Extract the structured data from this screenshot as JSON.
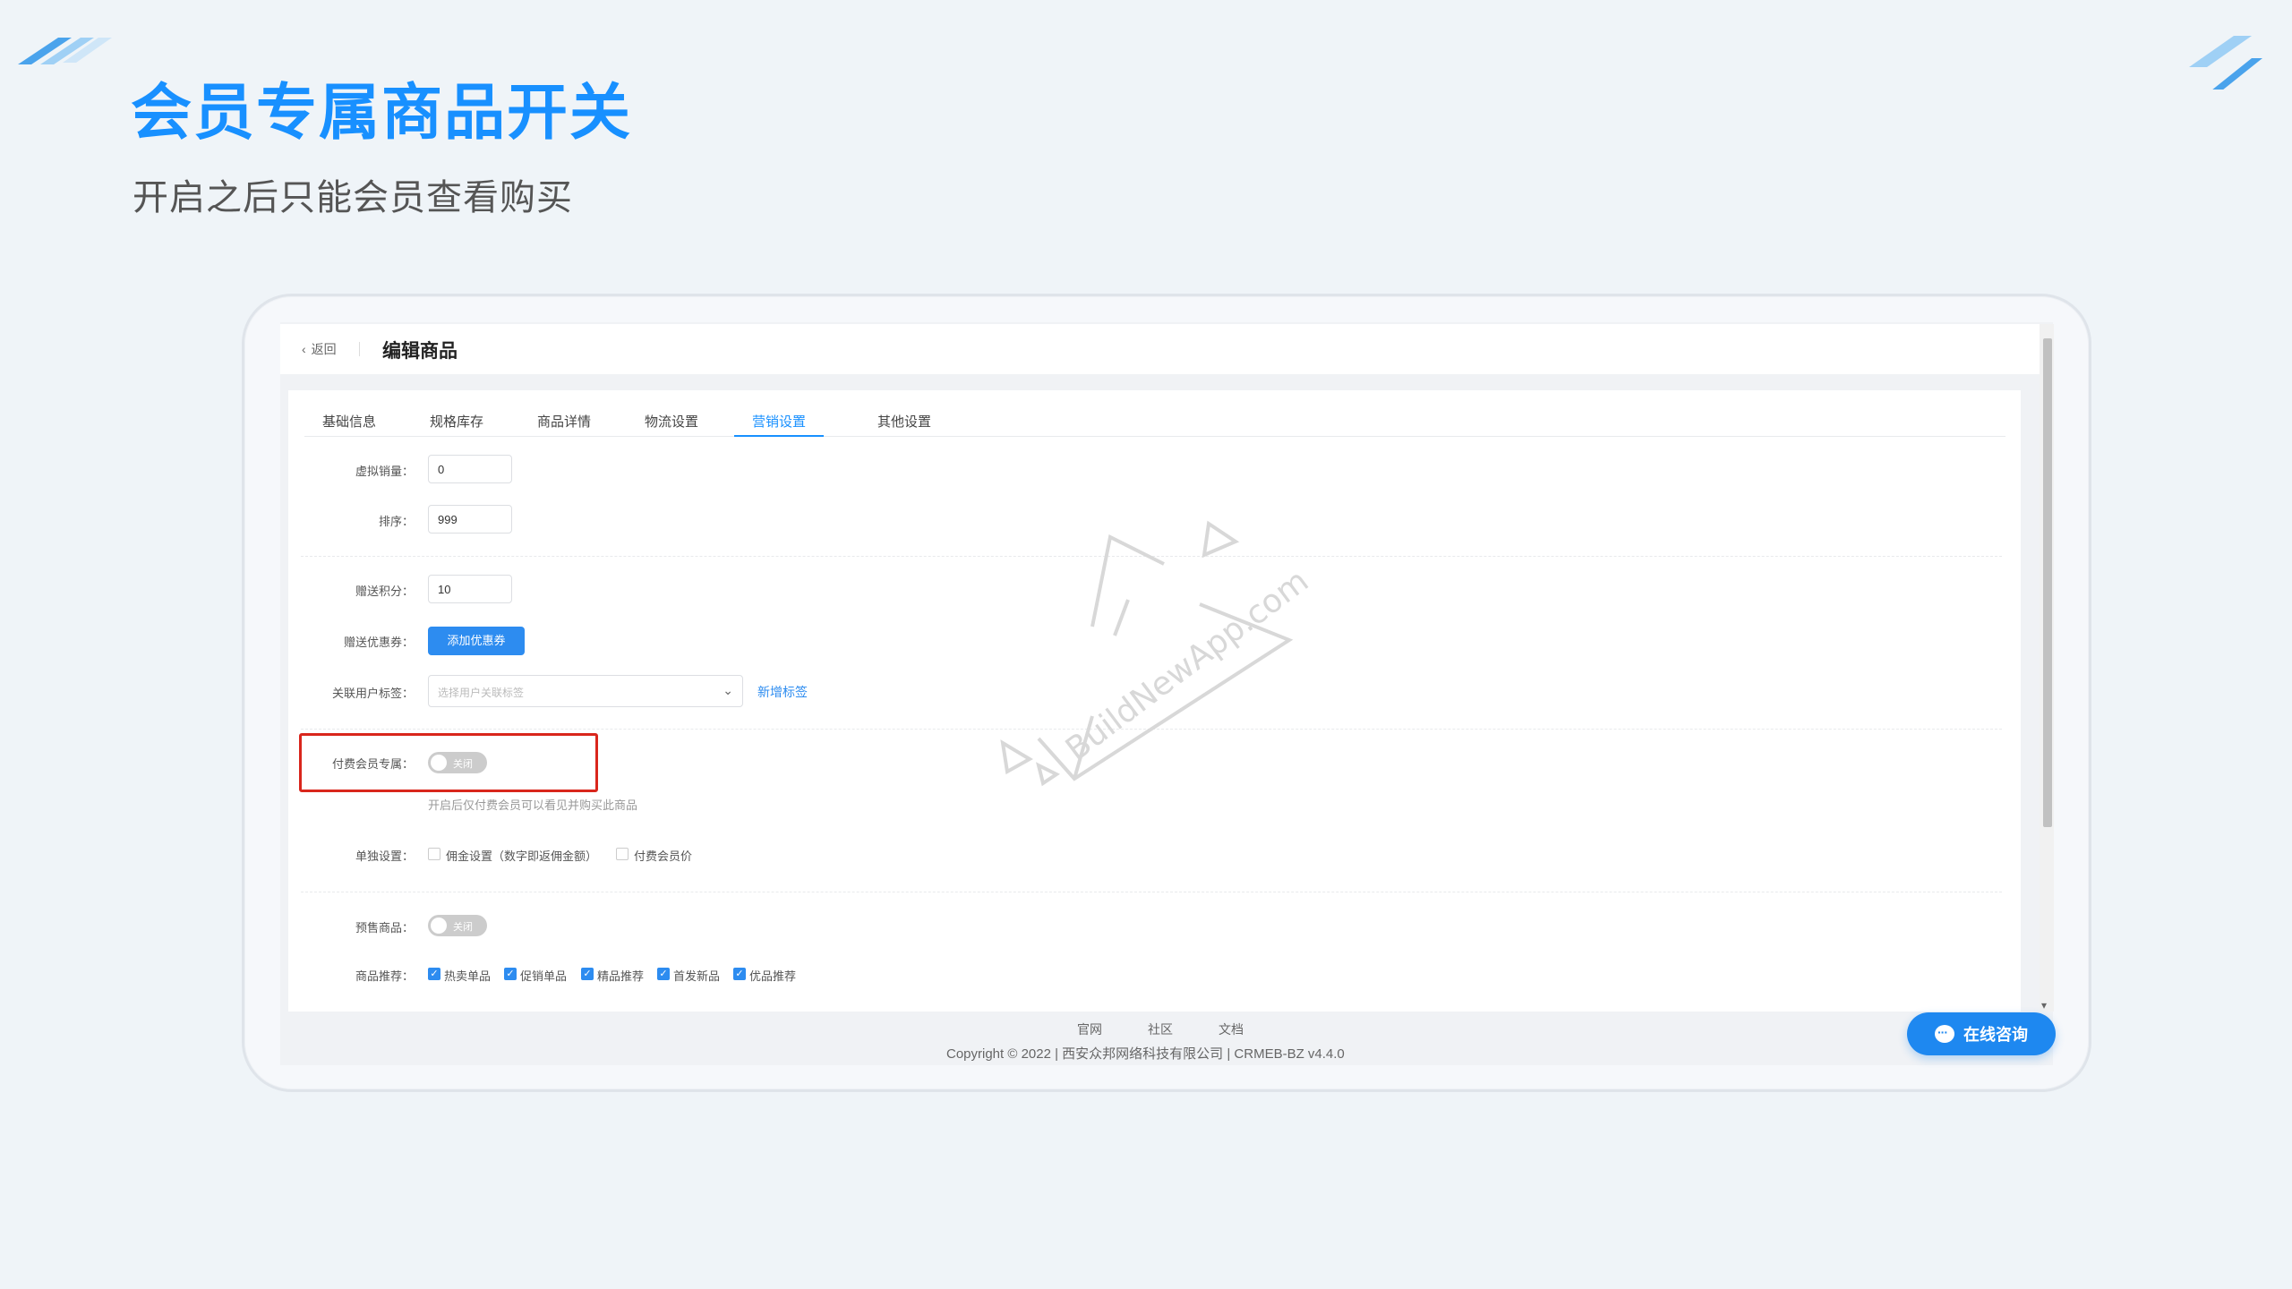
{
  "slide": {
    "title": "会员专属商品开关",
    "subtitle": "开启之后只能会员查看购买"
  },
  "topbar": {
    "back_label": "返回",
    "page_title": "编辑商品"
  },
  "tabs": [
    {
      "label": "基础信息"
    },
    {
      "label": "规格库存"
    },
    {
      "label": "商品详情"
    },
    {
      "label": "物流设置"
    },
    {
      "label": "营销设置",
      "active": true
    },
    {
      "label": "其他设置"
    }
  ],
  "form": {
    "virtual_sales": {
      "label": "虚拟销量：",
      "value": "0"
    },
    "sort": {
      "label": "排序：",
      "value": "999"
    },
    "points": {
      "label": "赠送积分：",
      "value": "10"
    },
    "coupon": {
      "label": "赠送优惠券：",
      "button": "添加优惠券"
    },
    "user_tags": {
      "label": "关联用户标签：",
      "placeholder": "选择用户关联标签",
      "new_link": "新增标签"
    },
    "vip_exclusive": {
      "label": "付费会员专属：",
      "switch_text": "关闭",
      "hint": "开启后仅付费会员可以看见并购买此商品"
    },
    "single_settings": {
      "label": "单独设置：",
      "option1": "佣金设置（数字即返佣金额）",
      "option2": "付费会员价"
    },
    "presale": {
      "label": "预售商品：",
      "switch_text": "关闭"
    },
    "recommend": {
      "label": "商品推荐：",
      "options": [
        "热卖单品",
        "促销单品",
        "精品推荐",
        "首发新品",
        "优品推荐"
      ]
    }
  },
  "footer": {
    "links": [
      "官网",
      "社区",
      "文档"
    ],
    "copyright": "Copyright © 2022 | 西安众邦网络科技有限公司 | CRMEB-BZ v4.4.0"
  },
  "consult_button": "在线咨询",
  "watermark": "BuildNewApp.com",
  "colors": {
    "accent": "#1890ff",
    "highlight": "#d9261c",
    "swatches": [
      "#ed4014",
      "#2d8cf0",
      "#19be6b",
      "#ff9900"
    ]
  },
  "icons": {
    "back": "chevron-left-icon",
    "select_caret": "chevron-down-icon",
    "check": "check-icon",
    "chat": "chat-icon"
  }
}
